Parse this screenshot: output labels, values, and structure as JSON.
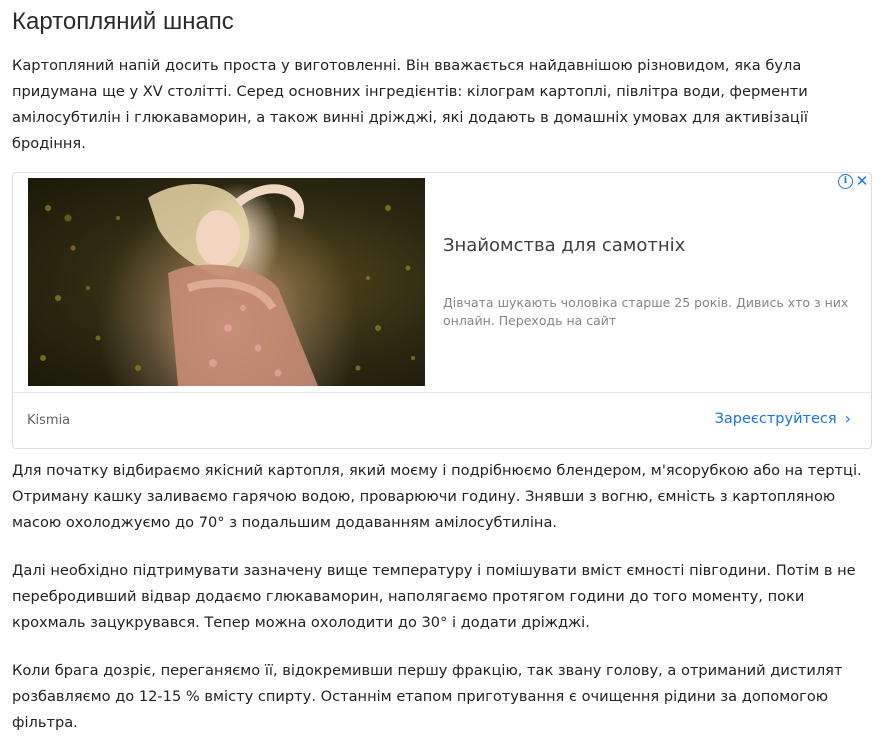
{
  "article": {
    "title": "Картопляний шнапс",
    "paragraphs": [
      "Картопляний напій досить проста у виготовленні. Він вважається найдавнішою різновидом, яка була придумана ще у XV столітті. Серед основних інгредієнтів: кілограм картоплі, півлітра води, ферменти амілосубтилін і глюкаваморин, а також винні дріжджі, які додають в домашніх умовах для активізації бродіння.",
      "Для початку відбираємо якісний картопля, який моєму і подрібнюємо блендером, м'ясорубкою або на тертці. Отриману кашку заливаємо гарячою водою, проварюючи годину. Знявши з вогню, ємність з картопляною масою охолоджуємо до 70° з подальшим додаванням амілосубтиліна.",
      "Далі необхідно підтримувати зазначену вище температуру і помішувати вміст ємності півгодини. Потім в не перебродивший відвар додаємо глюкаваморин, наполягаємо протягом години до того моменту, поки крохмаль зацукрувався. Тепер можна охолодити до 30° і додати дріжджі.",
      "Коли брага дозріє, переганяємо її, відокремивши першу фракцію, так звану голову, а отриманий дистилят розбавляємо до 12-15 % вмісту спирту. Останнім етапом приготування є очищення рідини за допомогою фільтра."
    ]
  },
  "ad": {
    "headline": "Знайомства для самотніх",
    "description": "Дівчата шукають чоловіка старше 25 років. Дивись хто з них онлайн. Переходь на сайт",
    "brand": "Kismia",
    "cta_label": "Зареєструйтеся",
    "cta_icon": "chevron-right-icon",
    "info_icon": "info-icon",
    "close_icon": "close-icon",
    "image_icon": "ad-photo",
    "accent_color": "#1a73e8"
  }
}
